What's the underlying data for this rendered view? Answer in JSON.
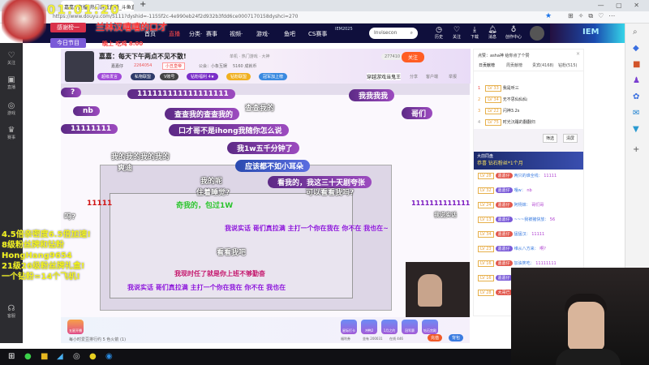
{
  "browser": {
    "tab_title": "嘉嘉!!直播_热门游戏直播_斗鱼直播",
    "url": "https://www.douyu.com/5111?dyshid=-1155f2c-4e990eb24f2d932b3fdd6ce0007170158dyshci=270",
    "window_controls": "— ▢ ✕"
  },
  "overlay": {
    "clock": "01:01:20",
    "thanks_label": "感谢榜一",
    "thanks_name": "兰林汉嘻嘻的口才",
    "program_label": "今日节目",
    "program_value": "晚上 吃鸡 8:00",
    "yellow_lines": [
      "4.5倍亲密度6.5倍加速!",
      "8级粉丝牌和钻粉",
      "HongHang9654",
      "21级26级粉丝牌礼盒!",
      "一个钻粉=14个飞机!"
    ]
  },
  "nav": {
    "items": [
      "首页",
      "直播",
      "分类·",
      "赛事",
      "视频·",
      "游戏·",
      "鱼吧",
      "CS赛事"
    ],
    "event": "IEM2025",
    "search_value": "Invisecon",
    "icons": [
      {
        "icon": "history-icon",
        "label": "历史"
      },
      {
        "icon": "heart-icon",
        "label": "关注"
      },
      {
        "icon": "download-icon",
        "label": "下载"
      },
      {
        "icon": "bell-icon",
        "label": "消息"
      },
      {
        "icon": "creator-icon",
        "label": "创作中心"
      }
    ],
    "banner": "IEM"
  },
  "leftbar": [
    {
      "icon": "heart-icon",
      "label": "关注"
    },
    {
      "icon": "video-icon",
      "label": "直播"
    },
    {
      "icon": "game-icon",
      "label": "游戏"
    },
    {
      "icon": "trophy-icon",
      "label": "赛事"
    },
    {
      "icon": "headset-icon",
      "label": "客服"
    }
  ],
  "room": {
    "title": "嘉嘉：每天下午两点不见不散!",
    "category": "单机 · 热门游戏 · 大神",
    "owner": "嘉嘉仔",
    "hot": "2264054",
    "tag": "小丑皇帝",
    "notice": "公会：小象互娱",
    "fans": "5160 成就币",
    "follow_count": "277410",
    "follow_label": "关注",
    "slogan": "穿越游戏当鬼王",
    "share": "分享",
    "client": "客户端",
    "report": "举报",
    "pills": [
      "超级发言",
      "私物联盟",
      "V账号",
      "钻粉福利 4★",
      "钻粉联盟",
      "冠军加上榜"
    ]
  },
  "danmaku": [
    "?",
    "111111111111111111",
    "我我我我",
    "查查我的",
    "nb",
    "查查我的查查我的",
    "哥们",
    "11111111",
    "口才哥不是ihong我随你怎么说",
    "我1w五千分钟了",
    "我的我的我的我的",
    "应该都不如小耳朵",
    "看我的，我这三十天剧夸张",
    "爽迪",
    "我的呢",
    "住着睡觉?",
    "可以看看我吗?",
    "11111",
    "奇我的，包过1W",
    "我说实话 哥们真拉满 主打一个你在我在 你不在 我也在~",
    "我现时任了就是你上班不够勤奋",
    "我说实话 哥们真拉满 主打一个你在我在 你不在 我也在",
    "看看我吧",
    "吗?",
    "我说实话",
    "1111111111111111"
  ],
  "chat": {
    "notice": "点赞：asha神 给你点了个赞",
    "tabs": [
      "日贡献榜",
      "周贡献榜",
      "贵宾(4168)",
      "钻粉(515)"
    ],
    "rank": [
      {
        "n": "1",
        "lv": "LV 33",
        "name": "我是听三"
      },
      {
        "n": "2",
        "lv": "LV 34",
        "name": "无不思仙仙仙"
      },
      {
        "n": "3",
        "lv": "LV 22",
        "name": "闪神3.2s"
      },
      {
        "n": "4",
        "lv": "LV 75",
        "name": "时光沉睡的翻翻归"
      }
    ],
    "buttons": [
      "筛选",
      "清屏"
    ],
    "banner_title": "大前同盘",
    "banner_text": "恭喜 钻石粉丝*1个月",
    "messages": [
      {
        "lv": "LV 28",
        "badge": "嘉嘉仔",
        "user": "两只的谁全线：",
        "text": "11111"
      },
      {
        "lv": "LV 32",
        "badge": "嘉嘉仔",
        "user": "嘎w：",
        "text": "nb"
      },
      {
        "lv": "LV 24",
        "badge": "嘉嘉仔",
        "user": "阿杨妹：",
        "text": "哥们哥"
      },
      {
        "lv": "LV 13",
        "badge": "嘉嘉仔",
        "user": "~~~我被猪快放：",
        "text": "56"
      },
      {
        "lv": "LV 34",
        "badge": "嘉嘉仔",
        "user": "猛猛汉：",
        "text": "11111"
      },
      {
        "lv": "LV 23",
        "badge": "嘉嘉仔",
        "user": "维从八方来：",
        "text": "啊?"
      },
      {
        "lv": "LV 16",
        "badge": "嘉嘉仔",
        "user": "加油笑吃：",
        "text": "11111111"
      },
      {
        "lv": "LV 16",
        "badge": "嘉嘉仔",
        "user": "口袋人0：",
        "text": "11111"
      },
      {
        "lv": "LV 28",
        "badge": "大哥已",
        "user": "早知怀疑的偷贝",
        "text": "111111"
      }
    ]
  },
  "giftbar": {
    "left_gift": "五星开播",
    "notice": "每小时爱豆排行约 5 色火箭 (1)",
    "gifts": [
      "星际打卡",
      "冲鸭2",
      "1月之约",
      "冠军赛",
      "钻石宫殿"
    ],
    "welfare": "福利券",
    "seats": "坐有 200031",
    "online": "在线 446",
    "charge_label": "充值",
    "backpack_label": "背包"
  },
  "colors": {
    "nav": "#0f0f3c",
    "accent": "#ff5d23",
    "danmaku": "#8a3bb5",
    "overlay_text": "#f3f31e"
  }
}
